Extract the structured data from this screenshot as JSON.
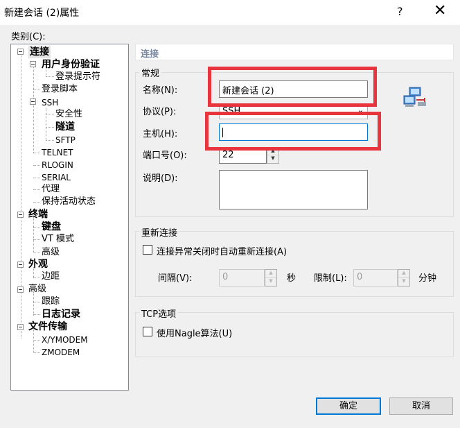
{
  "window": {
    "title": "新建会话 (2)属性",
    "help": "?",
    "close": "✕"
  },
  "category_label": "类别(C):",
  "tree": {
    "connection": "连接",
    "auth": "用户身份验证",
    "login_prompt": "登录提示符",
    "login_script": "登录脚本",
    "ssh": "SSH",
    "security": "安全性",
    "tunnel": "隧道",
    "sftp": "SFTP",
    "telnet": "TELNET",
    "rlogin": "RLOGIN",
    "serial": "SERIAL",
    "proxy": "代理",
    "keepalive": "保持活动状态",
    "terminal": "终端",
    "keyboard": "键盘",
    "vt_mode": "VT 模式",
    "advanced1": "高级",
    "appearance": "外观",
    "margin": "边距",
    "advanced2": "高级",
    "trace": "跟踪",
    "log": "日志记录",
    "file_transfer": "文件传输",
    "xymodem": "X/YMODEM",
    "zmodem": "ZMODEM"
  },
  "panel": {
    "header": "连接",
    "general": {
      "label": "常规",
      "name_label": "名称(N):",
      "name_value": "新建会话 (2)",
      "protocol_label": "协议(P):",
      "protocol_value": "SSH",
      "host_label": "主机(H):",
      "host_value": "",
      "port_label": "端口号(O):",
      "port_value": "22",
      "desc_label": "说明(D):",
      "desc_value": ""
    },
    "reconnect": {
      "label": "重新连接",
      "checkbox": "连接异常关闭时自动重新连接(A)",
      "interval_label": "间隔(V):",
      "interval_value": "0",
      "sec": "秒",
      "limit_label": "限制(L):",
      "limit_value": "0",
      "min": "分钟"
    },
    "tcp": {
      "label": "TCP选项",
      "checkbox": "使用Nagle算法(U)"
    }
  },
  "buttons": {
    "ok": "确定",
    "cancel": "取消"
  },
  "colors": {
    "highlight": "#e8343c",
    "focus": "#0078d7"
  }
}
